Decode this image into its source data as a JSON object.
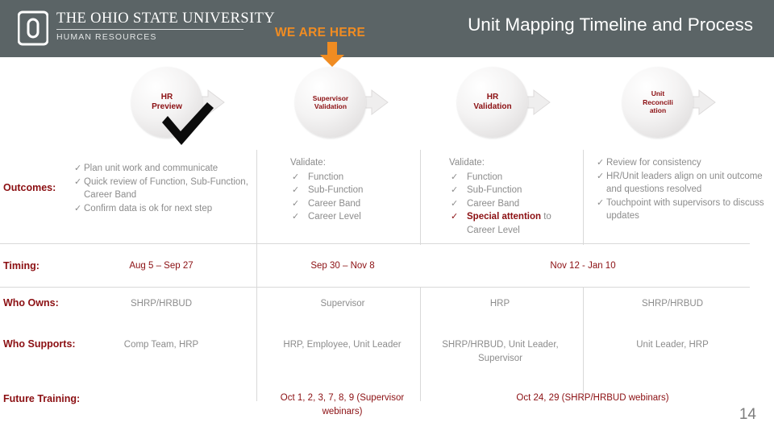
{
  "header": {
    "institution": "THE OHIO STATE UNIVERSITY",
    "department": "HUMAN RESOURCES",
    "we_are_here": "WE ARE HERE",
    "title": "Unit Mapping Timeline and Process",
    "colors": {
      "bar": "#5b6466",
      "accent_orange": "#f08c22",
      "brand_red": "#8b0f12"
    }
  },
  "steps": [
    {
      "label": "HR\nPreview",
      "line1": "HR",
      "line2": "Preview",
      "line3": "",
      "completed": true
    },
    {
      "label": "Supervisor Validation",
      "line1": "Supervisor",
      "line2": "Validation",
      "line3": "",
      "completed": false
    },
    {
      "label": "HR Validation",
      "line1": "HR",
      "line2": "Validation",
      "line3": "",
      "completed": false
    },
    {
      "label": "Unit Reconciliation",
      "line1": "Unit",
      "line2": "Reconcili",
      "line3": "ation",
      "completed": false
    }
  ],
  "rows": {
    "outcomes": {
      "label": "Outcomes:",
      "columns": [
        {
          "type": "list",
          "items": [
            "Plan unit work and communicate",
            "Quick review of Function, Sub-Function, Career Band",
            "Confirm data is ok for next step"
          ]
        },
        {
          "type": "heading-list",
          "heading": "Validate:",
          "items": [
            "Function",
            "Sub-Function",
            "Career Band",
            "Career Level"
          ]
        },
        {
          "type": "heading-list",
          "heading": "Validate:",
          "items": [
            "Function",
            "Sub-Function",
            "Career Band"
          ],
          "emphasis_item": {
            "strong": "Special attention",
            "rest": " to Career Level"
          }
        },
        {
          "type": "list",
          "items": [
            "Review for consistency",
            "HR/Unit leaders align on unit outcome and questions resolved",
            "Touchpoint with supervisors to discuss updates"
          ]
        }
      ]
    },
    "timing": {
      "label": "Timing:",
      "columns": [
        "Aug 5 – Sep 27",
        "Sep 30 – Nov 8",
        "Nov 12 - Jan 10"
      ]
    },
    "who_owns": {
      "label": "Who Owns:",
      "columns": [
        "SHRP/HRBUD",
        "Supervisor",
        "HRP",
        "SHRP/HRBUD"
      ]
    },
    "who_supports": {
      "label": "Who Supports:",
      "columns": [
        "Comp Team, HRP",
        "HRP, Employee, Unit Leader",
        "SHRP/HRBUD, Unit Leader, Supervisor",
        "Unit Leader, HRP"
      ]
    },
    "future_training": {
      "label": "Future Training:",
      "columns": [
        "",
        "Oct 1, 2, 3, 7, 8, 9 (Supervisor webinars)",
        "Oct 24, 29 (SHRP/HRBUD webinars)"
      ]
    }
  },
  "footer": {
    "page_number": "14"
  }
}
